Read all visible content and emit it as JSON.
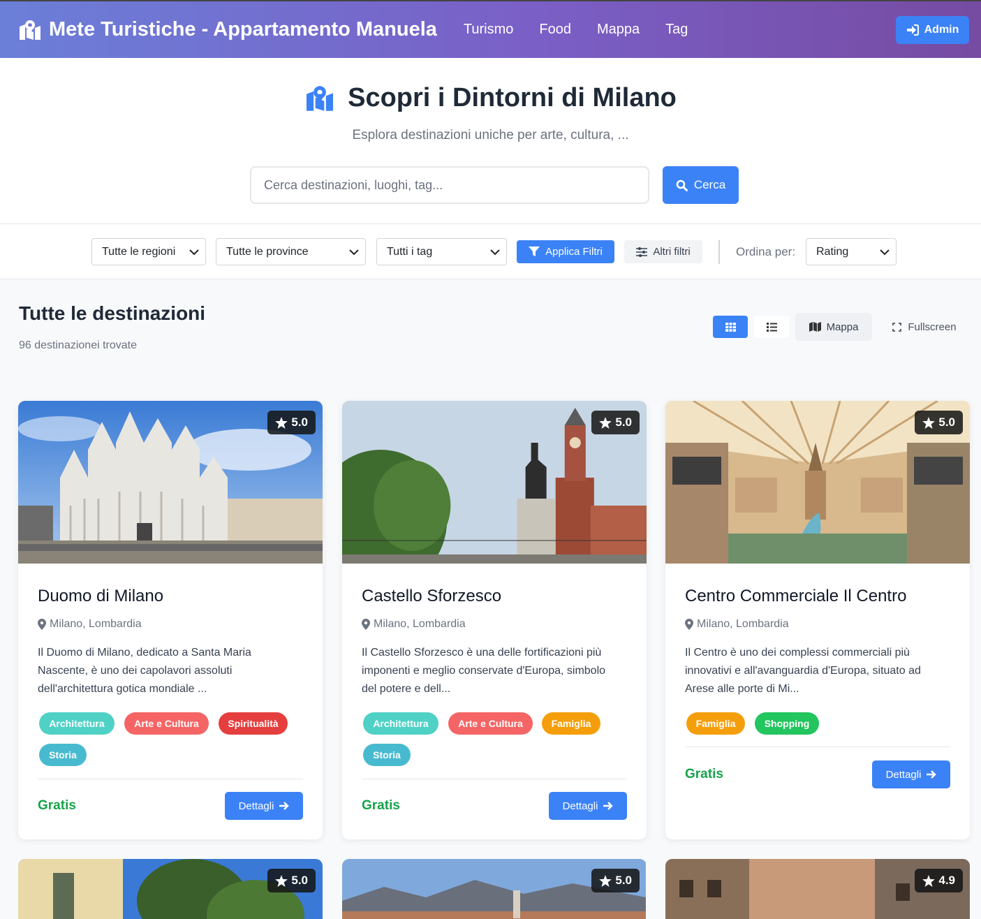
{
  "navbar": {
    "brand": "Mete Turistiche - Appartamento Manuela",
    "links": [
      "Turismo",
      "Food",
      "Mappa",
      "Tag"
    ],
    "admin_label": "Admin"
  },
  "hero": {
    "title": "Scopri i Dintorni di Milano",
    "subtitle": "Esplora destinazioni uniche per arte, cultura, ...",
    "search_placeholder": "Cerca destinazioni, luoghi, tag...",
    "search_button": "Cerca"
  },
  "filters": {
    "region": "Tutte le regioni",
    "province": "Tutte le province",
    "tag": "Tutti i tag",
    "apply_label": "Applica Filtri",
    "more_label": "Altri filtri",
    "sort_label": "Ordina per:",
    "sort_value": "Rating"
  },
  "list": {
    "title": "Tutte le destinazioni",
    "count": "96 destinazionei trovate",
    "map_label": "Mappa",
    "fullscreen_label": "Fullscreen"
  },
  "colors": {
    "primary": "#3b82f6",
    "gradient_start": "#6b7fd8",
    "gradient_end": "#764ba2",
    "price": "#16a34a"
  },
  "tag_colors": {
    "Architettura": "#4fd1c5",
    "Arte e Cultura": "#f56565",
    "Spiritualità": "#e53e3e",
    "Storia": "#48bacf",
    "Famiglia": "#f59e0b",
    "Shopping": "#22c55e"
  },
  "cards": [
    {
      "title": "Duomo di Milano",
      "location": "Milano, Lombardia",
      "rating": "5.0",
      "description": "Il Duomo di Milano, dedicato a Santa Maria Nascente, è uno dei capolavori assoluti dell'architettura gotica mondiale ...",
      "tags": [
        "Architettura",
        "Arte e Cultura",
        "Spiritualità",
        "Storia"
      ],
      "price": "Gratis",
      "button": "Dettagli"
    },
    {
      "title": "Castello Sforzesco",
      "location": "Milano, Lombardia",
      "rating": "5.0",
      "description": "Il Castello Sforzesco è una delle fortificazioni più imponenti e meglio conservate d'Europa, simbolo del potere e dell...",
      "tags": [
        "Architettura",
        "Arte e Cultura",
        "Famiglia",
        "Storia"
      ],
      "price": "Gratis",
      "button": "Dettagli"
    },
    {
      "title": "Centro Commerciale Il Centro",
      "location": "Milano, Lombardia",
      "rating": "5.0",
      "description": "Il Centro è uno dei complessi commerciali più innovativi e all'avanguardia d'Europa, situato ad Arese alle porte di Mi...",
      "tags": [
        "Famiglia",
        "Shopping"
      ],
      "price": "Gratis",
      "button": "Dettagli"
    }
  ],
  "next_row_ratings": [
    "5.0",
    "5.0",
    "4.9"
  ]
}
